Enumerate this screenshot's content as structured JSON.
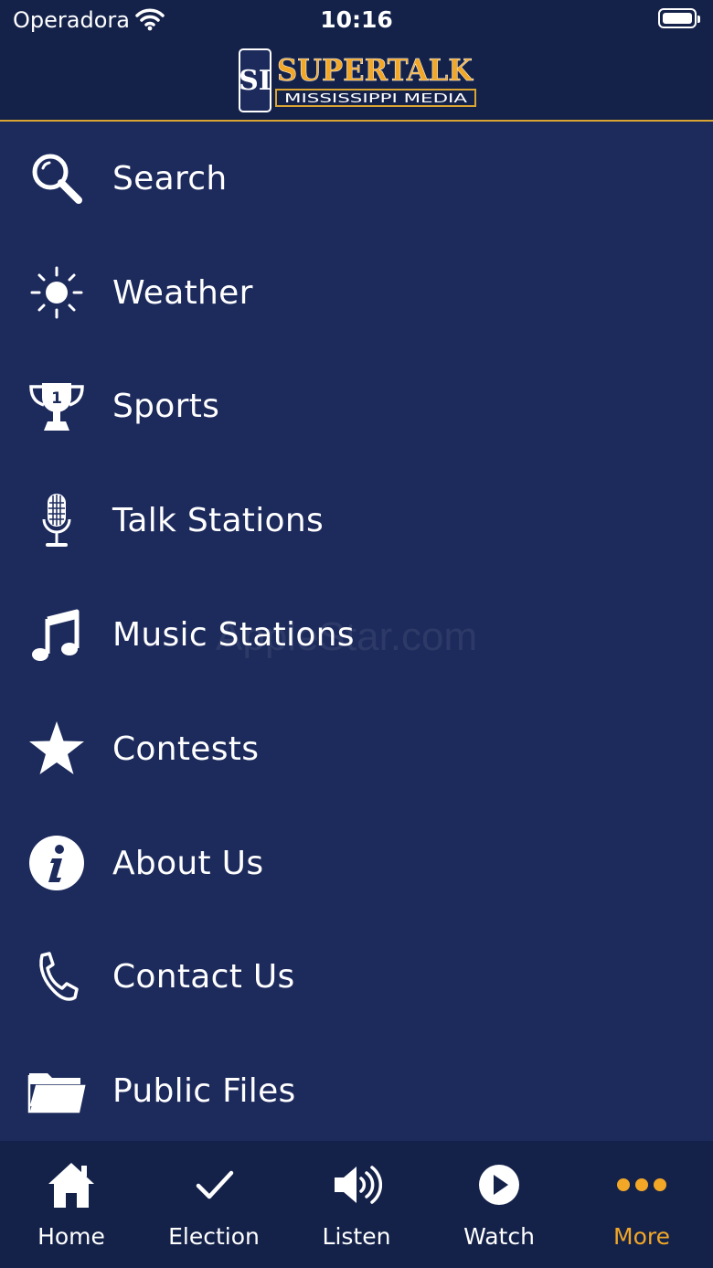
{
  "status_bar": {
    "carrier": "Operadora",
    "time": "10:16"
  },
  "header": {
    "logo_icon": "SI",
    "logo_top": "SUPERTALK",
    "logo_bottom": "MISSISSIPPI MEDIA"
  },
  "menu": {
    "items": [
      {
        "label": "Search",
        "icon": "search-icon"
      },
      {
        "label": "Weather",
        "icon": "sun-icon"
      },
      {
        "label": "Sports",
        "icon": "trophy-icon"
      },
      {
        "label": "Talk Stations",
        "icon": "microphone-icon"
      },
      {
        "label": "Music Stations",
        "icon": "music-note-icon"
      },
      {
        "label": "Contests",
        "icon": "star-icon"
      },
      {
        "label": "About Us",
        "icon": "info-icon"
      },
      {
        "label": "Contact Us",
        "icon": "phone-icon"
      },
      {
        "label": "Public Files",
        "icon": "folder-icon"
      }
    ]
  },
  "tabbar": {
    "active": "More",
    "items": [
      {
        "label": "Home",
        "icon": "home-icon"
      },
      {
        "label": "Election",
        "icon": "checkmark-icon"
      },
      {
        "label": "Listen",
        "icon": "speaker-icon"
      },
      {
        "label": "Watch",
        "icon": "play-icon"
      },
      {
        "label": "More",
        "icon": "more-dots-icon"
      }
    ]
  },
  "colors": {
    "background": "#1c2a5c",
    "header": "#14224a",
    "accent": "#f2a727"
  },
  "watermark": "AppleStar.com"
}
